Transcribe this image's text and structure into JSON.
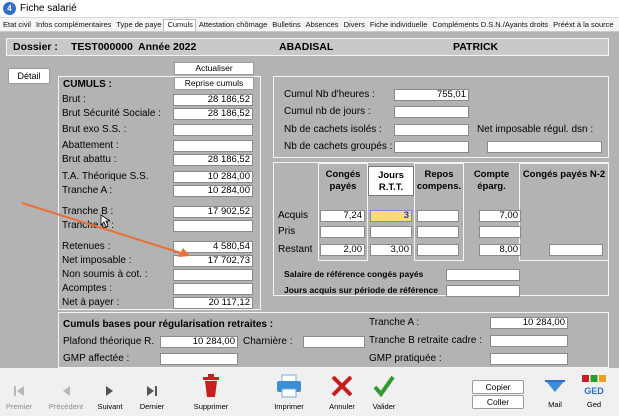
{
  "window": {
    "title": "Fiche salarié"
  },
  "tabs": [
    "Etat civil",
    "Infos complémentaires",
    "Type de paye",
    "Cumuls",
    "Attestation chômage",
    "Bulletins",
    "Absences",
    "Divers",
    "Fiche individuelle",
    "Compléments D.S.N./Ayants droits",
    "Prééxt à la source"
  ],
  "active_tab": "Cumuls",
  "dossier": {
    "label": "Dossier :",
    "code": "TEST000000",
    "annee": "Année 2022",
    "nom": "ABADISAL",
    "prenom": "PATRICK"
  },
  "buttons": {
    "detail": "Détail",
    "actualiser": "Actualiser",
    "reprise": "Reprise cumuls"
  },
  "cumuls": {
    "title": "CUMULS :",
    "rows": [
      {
        "label": "Brut :",
        "value": "28 186,52"
      },
      {
        "label": "Brut Sécurité Sociale :",
        "value": "28 186,52"
      },
      {
        "label": "Brut exo S.S. :",
        "value": ""
      },
      {
        "label": "Abattement :",
        "value": ""
      },
      {
        "label": "Brut abattu :",
        "value": "28 186,52"
      },
      {
        "label": "T.A. Théorique S.S.",
        "value": "10 284,00"
      },
      {
        "label": "Tranche A :",
        "value": "10 284,00"
      },
      {
        "label": "Tranche B :",
        "value": "17 902,52"
      },
      {
        "label": "Tranche C :",
        "value": ""
      },
      {
        "label": "Retenues :",
        "value": "4 580,54"
      },
      {
        "label": "Net imposable :",
        "value": "17 702,73"
      },
      {
        "label": "Non soumis à cot. :",
        "value": ""
      },
      {
        "label": "Acomptes :",
        "value": ""
      },
      {
        "label": "Net à payer :",
        "value": "20 117,12"
      }
    ]
  },
  "heures": {
    "cumul_heures_label": "Cumul Nb d'heures :",
    "cumul_heures_value": "755,01",
    "cumul_jours_label": "Cumul nb de jours :",
    "cumul_jours_value": "",
    "cachets_isoles_label": "Nb de cachets isolés :",
    "cachets_isoles_value": "",
    "net_regul_label": "Net imposable régul. dsn :",
    "cachets_groupes_label": "Nb de cachets groupés :",
    "cachets_groupes_value": ""
  },
  "conges": {
    "headers": [
      "Congés payés",
      "Jours R.T.T.",
      "Repos compens.",
      "Compte éparg.",
      "Congés payés N-2"
    ],
    "rows": [
      {
        "label": "Acquis",
        "values": [
          "7,24",
          "3",
          "",
          "7,00",
          ""
        ]
      },
      {
        "label": "Pris",
        "values": [
          "",
          "",
          "",
          "",
          ""
        ]
      },
      {
        "label": "Restant",
        "values": [
          "2,00",
          "3,00",
          "",
          "8,00",
          ""
        ]
      }
    ],
    "salaire_ref_label": "Salaire de référence congés payés",
    "jours_ref_label": "Jours acquis sur période de référence"
  },
  "retraites": {
    "title": "Cumuls bases pour régularisation retraites :",
    "plafond_label": "Plafond théorique R.",
    "plafond_value": "10 284,00",
    "charniere_label": "Charnière :",
    "gmp_affectee_label": "GMP affectée :",
    "tranche_a_label": "Tranche A :",
    "tranche_a_value": "10 284,00",
    "tranche_b_label": "Tranche B retraite cadre :",
    "gmp_pratiquee_label": "GMP pratiquée :"
  },
  "toolbar": {
    "premier": "Premier",
    "precedent": "Précédent",
    "suivant": "Suivant",
    "dernier": "Dernier",
    "supprimer": "Supprimer",
    "imprimer": "Imprimer",
    "annuler": "Annuler",
    "valider": "Valider",
    "copier": "Copier",
    "coller": "Coller",
    "mail": "Mail",
    "ged": "Ged",
    "ged_logo": "GED"
  },
  "colors": {
    "highlight": "#ffd97a",
    "arrow": "#e8703a",
    "red": "#c81e1e",
    "green": "#2e9b2e",
    "blue": "#2e6fc9"
  }
}
